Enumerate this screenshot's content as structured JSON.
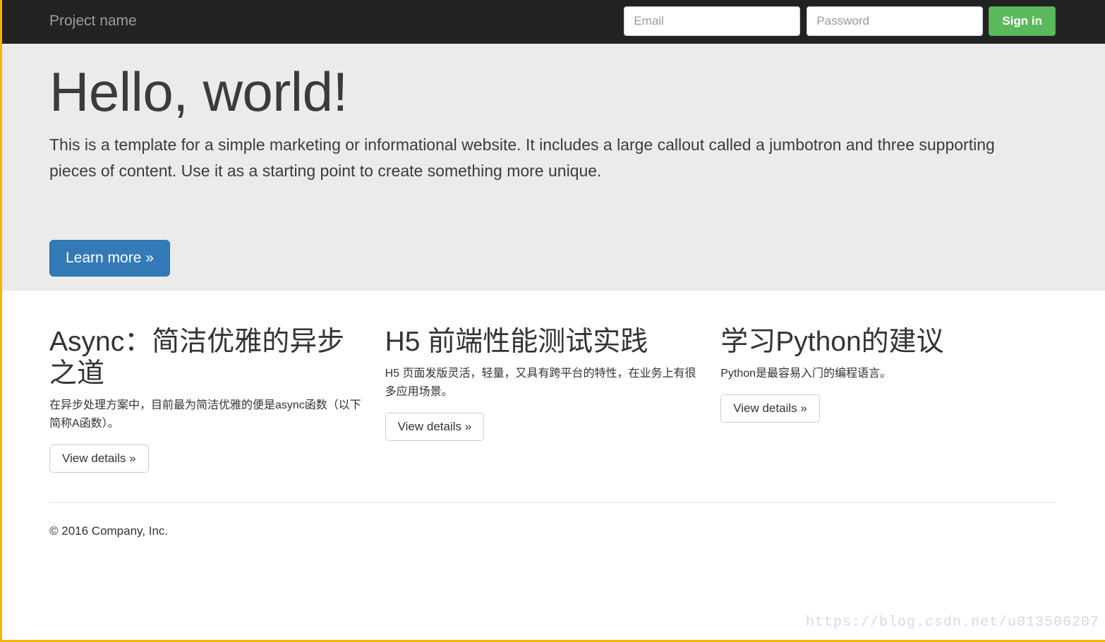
{
  "navbar": {
    "brand": "Project name",
    "email": {
      "placeholder": "Email",
      "value": ""
    },
    "password": {
      "placeholder": "Password",
      "value": ""
    },
    "signin_label": "Sign in",
    "background_color": "#222222",
    "brand_color": "#9d9d9d",
    "signin_color": "#5cb85c"
  },
  "jumbotron": {
    "title": "Hello, world!",
    "lead": "This is a template for a simple marketing or informational website. It includes a large callout called a jumbotron and three supporting pieces of content. Use it as a starting point to create something more unique.",
    "cta_label": "Learn more »",
    "background_color": "#ebebeb",
    "cta_color": "#337ab7"
  },
  "columns": [
    {
      "title": "Async：简洁优雅的异步之道",
      "description": "在异步处理方案中，目前最为简洁优雅的便是async函数（以下简称A函数）。",
      "button_label": "View details »"
    },
    {
      "title": "H5 前端性能测试实践",
      "description": "H5 页面发版灵活，轻量，又具有跨平台的特性，在业务上有很多应用场景。",
      "button_label": "View details »"
    },
    {
      "title": "学习Python的建议",
      "description": "Python是最容易入门的编程语言。",
      "button_label": "View details »"
    }
  ],
  "footer": {
    "copyright": "© 2016 Company, Inc."
  },
  "watermark": {
    "text": "https://blog.csdn.net/u013506207"
  }
}
